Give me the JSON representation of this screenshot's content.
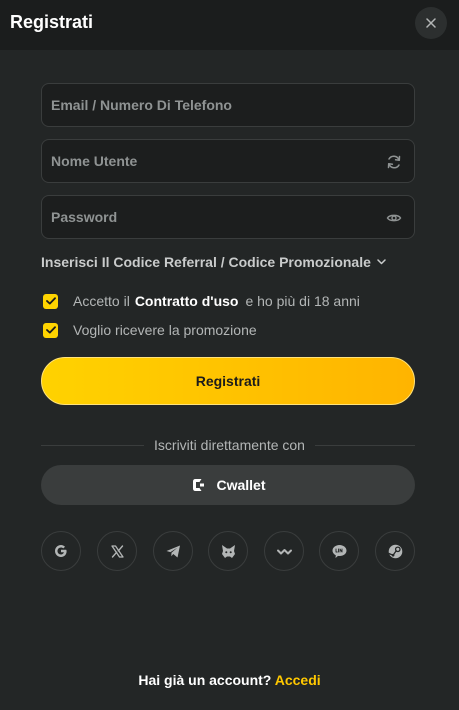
{
  "header": {
    "title": "Registrati",
    "close_icon": "close-icon"
  },
  "form": {
    "email": {
      "placeholder": "Email / Numero Di Telefono",
      "value": ""
    },
    "username": {
      "placeholder": "Nome Utente",
      "value": "",
      "icon": "refresh-icon"
    },
    "password": {
      "placeholder": "Password",
      "value": "",
      "icon": "eye-icon"
    },
    "referral_label": "Inserisci Il Codice Referral / Codice Promozionale",
    "terms": {
      "checked": true,
      "prefix": "Accetto il",
      "link": "Contratto d'uso",
      "suffix": "e ho più di 18 anni"
    },
    "promo": {
      "checked": true,
      "label": "Voglio ricevere la promozione"
    },
    "submit_label": "Registrati"
  },
  "alt_signup": {
    "divider_text": "Iscriviti direttamente con",
    "cwallet_label": "Cwallet",
    "social": [
      "google-icon",
      "x-icon",
      "telegram-icon",
      "metamask-icon",
      "walletconnect-icon",
      "line-icon",
      "steam-icon"
    ]
  },
  "footer": {
    "prompt": "Hai già un account?",
    "link": "Accedi"
  },
  "colors": {
    "accent": "#ffc800",
    "background": "#232626",
    "header": "#1b1d1d"
  }
}
